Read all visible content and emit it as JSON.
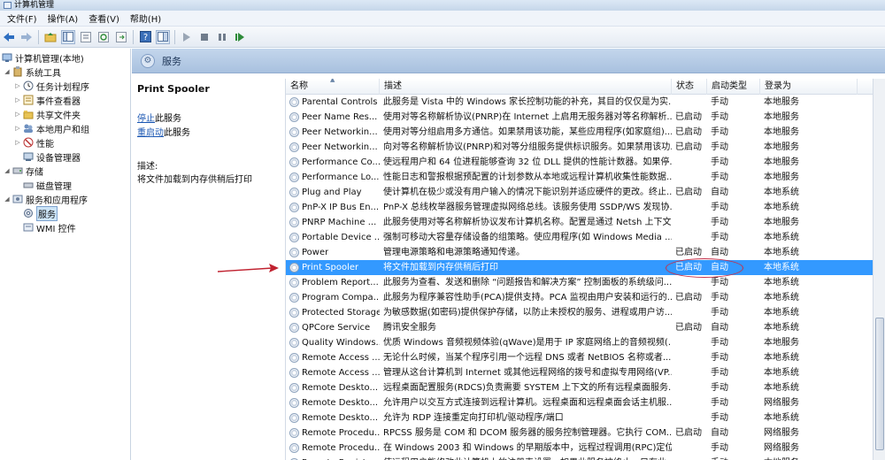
{
  "window": {
    "title": "计算机管理"
  },
  "menu": [
    "文件(F)",
    "操作(A)",
    "查看(V)",
    "帮助(H)"
  ],
  "toolbar_icons": [
    "back-icon",
    "forward-icon",
    "up-folder-icon",
    "show-hide-tree-icon",
    "properties-icon",
    "refresh-icon",
    "export-icon",
    "help-icon",
    "view-icon",
    "play-icon",
    "stop-icon",
    "pause-icon",
    "restart-icon"
  ],
  "tree": [
    {
      "label": "计算机管理(本地)",
      "level": 0
    },
    {
      "label": "系统工具",
      "level": 1
    },
    {
      "label": "任务计划程序",
      "level": 2
    },
    {
      "label": "事件查看器",
      "level": 2
    },
    {
      "label": "共享文件夹",
      "level": 2
    },
    {
      "label": "本地用户和组",
      "level": 2
    },
    {
      "label": "性能",
      "level": 2
    },
    {
      "label": "设备管理器",
      "level": 2
    },
    {
      "label": "存储",
      "level": 1
    },
    {
      "label": "磁盘管理",
      "level": 2
    },
    {
      "label": "服务和应用程序",
      "level": 1
    },
    {
      "label": "服务",
      "level": 2
    },
    {
      "label": "WMI 控件",
      "level": 2
    }
  ],
  "header_band": {
    "title": "服务"
  },
  "details": {
    "service_name": "Print Spooler",
    "stop_link": "停止",
    "stop_suffix": "此服务",
    "restart_link": "重启动",
    "restart_suffix": "此服务",
    "desc_label": "描述:",
    "desc_text": "将文件加载到内存供稍后打印"
  },
  "columns": {
    "name": "名称",
    "desc": "描述",
    "status": "状态",
    "startup": "启动类型",
    "logon": "登录为"
  },
  "rows": [
    {
      "name": "Parental Controls",
      "desc": "此服务是 Vista 中的 Windows 家长控制功能的补充，其目的仅仅是为实...",
      "status": "",
      "startup": "手动",
      "logon": "本地服务"
    },
    {
      "name": "Peer Name Res...",
      "desc": "使用对等名称解析协议(PNRP)在 Internet 上启用无服务器对等名称解析...",
      "status": "已启动",
      "startup": "手动",
      "logon": "本地服务"
    },
    {
      "name": "Peer Networkin...",
      "desc": "使用对等分组启用多方通信。如果禁用该功能，某些应用程序(如家庭组)...",
      "status": "已启动",
      "startup": "手动",
      "logon": "本地服务"
    },
    {
      "name": "Peer Networkin...",
      "desc": "向对等名称解析协议(PNRP)和对等分组服务提供标识服务。如果禁用该功...",
      "status": "已启动",
      "startup": "手动",
      "logon": "本地服务"
    },
    {
      "name": "Performance Co...",
      "desc": "使远程用户和 64 位进程能够查询 32 位 DLL 提供的性能计数器。如果停...",
      "status": "",
      "startup": "手动",
      "logon": "本地服务"
    },
    {
      "name": "Performance Lo...",
      "desc": "性能日志和警报根据预配置的计划参数从本地或远程计算机收集性能数据...",
      "status": "",
      "startup": "手动",
      "logon": "本地服务"
    },
    {
      "name": "Plug and Play",
      "desc": "使计算机在极少或没有用户输入的情况下能识别并适应硬件的更改。终止...",
      "status": "已启动",
      "startup": "自动",
      "logon": "本地系统"
    },
    {
      "name": "PnP-X IP Bus En...",
      "desc": "PnP-X 总线枚举器服务管理虚拟网络总线。该服务使用 SSDP/WS 发现协...",
      "status": "",
      "startup": "手动",
      "logon": "本地系统"
    },
    {
      "name": "PNRP Machine ...",
      "desc": "此服务使用对等名称解析协议发布计算机名称。配置是通过 Netsh 上下文...",
      "status": "",
      "startup": "手动",
      "logon": "本地服务"
    },
    {
      "name": "Portable Device ...",
      "desc": "强制可移动大容量存储设备的组策略。使应用程序(如 Windows Media ...",
      "status": "",
      "startup": "手动",
      "logon": "本地系统"
    },
    {
      "name": "Power",
      "desc": "管理电源策略和电源策略通知传递。",
      "status": "已启动",
      "startup": "自动",
      "logon": "本地系统"
    },
    {
      "name": "Print Spooler",
      "desc": "将文件加载到内存供稍后打印",
      "status": "已启动",
      "startup": "自动",
      "logon": "本地系统",
      "selected": true
    },
    {
      "name": "Problem Report...",
      "desc": "此服务为查看、发送和删除 “问题报告和解决方案” 控制面板的系统级问...",
      "status": "",
      "startup": "手动",
      "logon": "本地系统"
    },
    {
      "name": "Program Compa...",
      "desc": "此服务为程序兼容性助手(PCA)提供支持。PCA 监视由用户安装和运行的...",
      "status": "已启动",
      "startup": "手动",
      "logon": "本地系统"
    },
    {
      "name": "Protected Storage",
      "desc": "为敏感数据(如密码)提供保护存储，以防止未授权的服务、进程或用户访...",
      "status": "",
      "startup": "手动",
      "logon": "本地系统"
    },
    {
      "name": "QPCore Service",
      "desc": "腾讯安全服务",
      "status": "已启动",
      "startup": "自动",
      "logon": "本地系统"
    },
    {
      "name": "Quality Windows...",
      "desc": "优质 Windows 音频视频体验(qWave)是用于 IP 家庭网络上的音频视频(...",
      "status": "",
      "startup": "手动",
      "logon": "本地服务"
    },
    {
      "name": "Remote Access ...",
      "desc": "无论什么时候，当某个程序引用一个远程 DNS 或者 NetBIOS 名称或者...",
      "status": "",
      "startup": "手动",
      "logon": "本地系统"
    },
    {
      "name": "Remote Access ...",
      "desc": "管理从这台计算机到 Internet 或其他远程网络的拨号和虚拟专用网络(VP...",
      "status": "",
      "startup": "手动",
      "logon": "本地系统"
    },
    {
      "name": "Remote Deskto...",
      "desc": "远程桌面配置服务(RDCS)负责需要 SYSTEM 上下文的所有远程桌面服务...",
      "status": "",
      "startup": "手动",
      "logon": "本地系统"
    },
    {
      "name": "Remote Deskto...",
      "desc": "允许用户以交互方式连接到远程计算机。远程桌面和远程桌面会话主机服...",
      "status": "",
      "startup": "手动",
      "logon": "网络服务"
    },
    {
      "name": "Remote Deskto...",
      "desc": "允许为 RDP 连接重定向打印机/驱动程序/端口",
      "status": "",
      "startup": "手动",
      "logon": "本地系统"
    },
    {
      "name": "Remote Procedu...",
      "desc": "RPCSS 服务是 COM 和 DCOM 服务器的服务控制管理器。它执行 COM...",
      "status": "已启动",
      "startup": "自动",
      "logon": "网络服务"
    },
    {
      "name": "Remote Procedu...",
      "desc": "在 Windows 2003 和 Windows 的早期版本中，远程过程调用(RPC)定位...",
      "status": "",
      "startup": "手动",
      "logon": "网络服务"
    },
    {
      "name": "Remote Registry",
      "desc": "使远程用户能修改此计算机上的注册表设置。如果此服务被终止，只有此...",
      "status": "",
      "startup": "手动",
      "logon": "本地服务"
    }
  ]
}
